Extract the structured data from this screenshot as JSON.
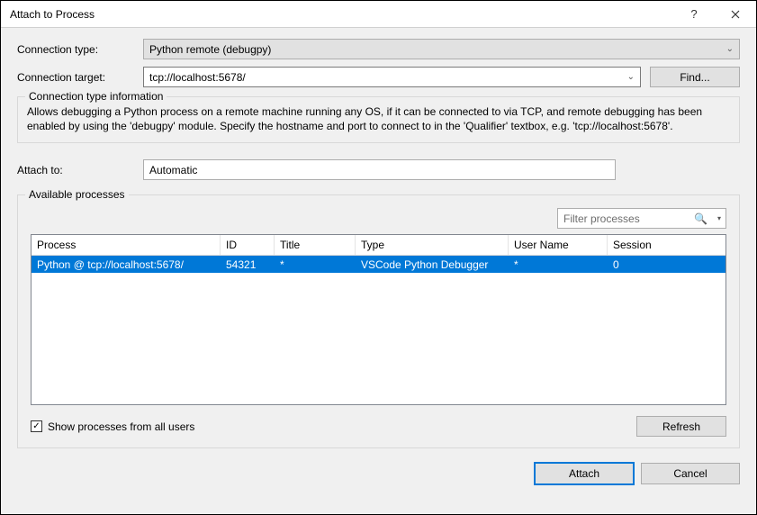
{
  "title": "Attach to Process",
  "connection_type_label": "Connection type:",
  "connection_type_value": "Python remote (debugpy)",
  "connection_target_label": "Connection target:",
  "connection_target_value": "tcp://localhost:5678/",
  "find_button": "Find...",
  "info_legend": "Connection type information",
  "info_text": "Allows debugging a Python process on a remote machine running any OS, if it can be connected to via TCP, and remote debugging has been enabled by using the 'debugpy' module. Specify the hostname and port to connect to in the 'Qualifier' textbox, e.g. 'tcp://localhost:5678'.",
  "attach_to_label": "Attach to:",
  "attach_to_value": "Automatic",
  "available_legend": "Available processes",
  "filter_placeholder": "Filter processes",
  "columns": {
    "process": "Process",
    "id": "ID",
    "title": "Title",
    "type": "Type",
    "user": "User Name",
    "session": "Session"
  },
  "rows": [
    {
      "process": "Python @ tcp://localhost:5678/",
      "id": "54321",
      "title": "*",
      "type": "VSCode Python Debugger",
      "user": "*",
      "session": "0"
    }
  ],
  "show_all_users_label": "Show processes from all users",
  "show_all_users_checked": "✓",
  "refresh_button": "Refresh",
  "attach_button": "Attach",
  "cancel_button": "Cancel"
}
